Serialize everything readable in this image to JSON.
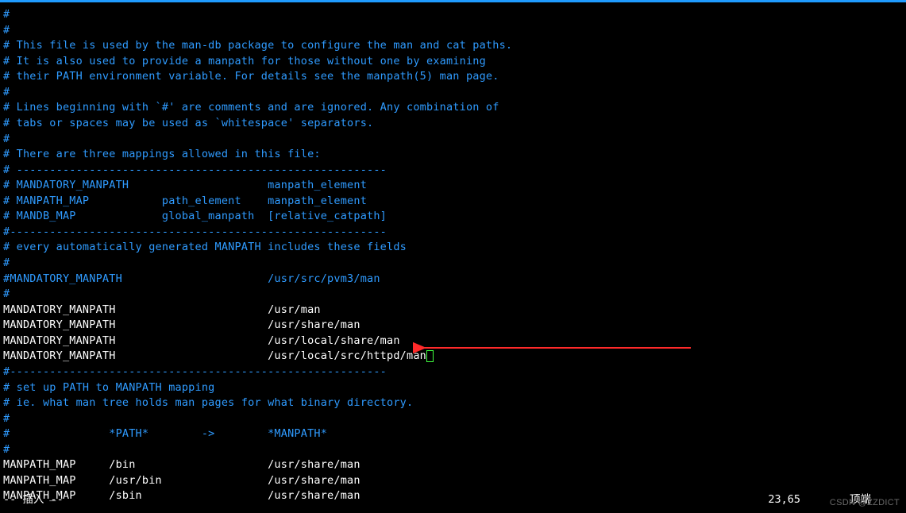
{
  "file_lines": [
    {
      "t": "comment",
      "text": "#"
    },
    {
      "t": "comment",
      "text": "#"
    },
    {
      "t": "comment",
      "text": "# This file is used by the man-db package to configure the man and cat paths."
    },
    {
      "t": "comment",
      "text": "# It is also used to provide a manpath for those without one by examining"
    },
    {
      "t": "comment",
      "text": "# their PATH environment variable. For details see the manpath(5) man page."
    },
    {
      "t": "comment",
      "text": "#"
    },
    {
      "t": "comment",
      "text": "# Lines beginning with `#' are comments and are ignored. Any combination of"
    },
    {
      "t": "comment",
      "text": "# tabs or spaces may be used as `whitespace' separators."
    },
    {
      "t": "comment",
      "text": "#"
    },
    {
      "t": "comment",
      "text": "# There are three mappings allowed in this file:"
    },
    {
      "t": "comment",
      "text": "# --------------------------------------------------------"
    },
    {
      "t": "comment",
      "text": "# MANDATORY_MANPATH                     manpath_element"
    },
    {
      "t": "comment",
      "text": "# MANPATH_MAP           path_element    manpath_element"
    },
    {
      "t": "comment",
      "text": "# MANDB_MAP             global_manpath  [relative_catpath]"
    },
    {
      "t": "comment",
      "text": "#---------------------------------------------------------"
    },
    {
      "t": "comment",
      "text": "# every automatically generated MANPATH includes these fields"
    },
    {
      "t": "comment",
      "text": "#"
    },
    {
      "t": "comment",
      "text": "#MANDATORY_MANPATH                      /usr/src/pvm3/man"
    },
    {
      "t": "comment",
      "text": "#"
    },
    {
      "t": "wh",
      "text": "MANDATORY_MANPATH                       /usr/man"
    },
    {
      "t": "wh",
      "text": "MANDATORY_MANPATH                       /usr/share/man"
    },
    {
      "t": "wh",
      "text": "MANDATORY_MANPATH                       /usr/local/share/man"
    },
    {
      "t": "wh",
      "text": "MANDATORY_MANPATH                       /usr/local/src/httpd/man",
      "cursor": true
    },
    {
      "t": "comment",
      "text": "#---------------------------------------------------------"
    },
    {
      "t": "comment",
      "text": "# set up PATH to MANPATH mapping"
    },
    {
      "t": "comment",
      "text": "# ie. what man tree holds man pages for what binary directory."
    },
    {
      "t": "comment",
      "text": "#"
    },
    {
      "t": "comment",
      "text": "#               *PATH*        ->        *MANPATH*"
    },
    {
      "t": "comment",
      "text": "#"
    },
    {
      "t": "wh",
      "text": "MANPATH_MAP     /bin                    /usr/share/man"
    },
    {
      "t": "wh",
      "text": "MANPATH_MAP     /usr/bin                /usr/share/man"
    },
    {
      "t": "wh",
      "text": "MANPATH_MAP     /sbin                   /usr/share/man"
    }
  ],
  "status": {
    "mode": "-- 插入 --",
    "position": "23,65",
    "scroll": "顶端"
  },
  "watermark": "CSDN @ZZDICT"
}
